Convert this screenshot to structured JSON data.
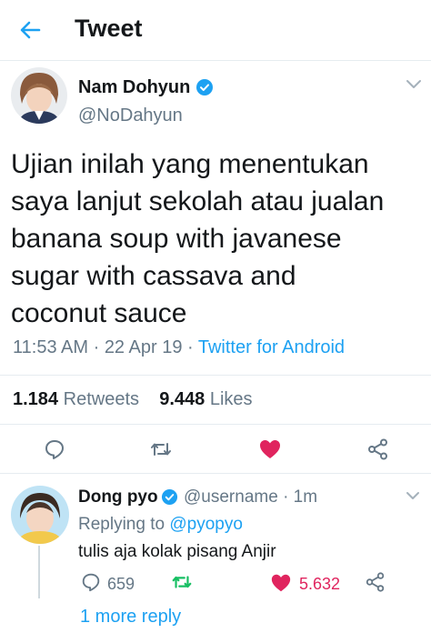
{
  "header": {
    "title": "Tweet"
  },
  "tweet": {
    "author_name": "Nam Dohyun",
    "author_handle": "@NoDahyun",
    "text_lines": [
      "Ujian inilah yang menentukan",
      "saya lanjut sekolah atau jualan",
      "banana soup with javanese",
      "sugar with cassava and",
      "coconut sauce"
    ],
    "time": "11:53 AM",
    "date": "22 Apr 19",
    "source": "Twitter for Android",
    "retweets_count": "1.184",
    "retweets_label": "Retweets",
    "likes_count": "9.448",
    "likes_label": "Likes",
    "liked": true
  },
  "reply": {
    "author_name": "Dong pyo",
    "author_handle": "@username",
    "time_ago": "1m",
    "replying_label": "Replying to",
    "replying_to": "@pyopyo",
    "text": "tulis aja kolak pisang Anjir",
    "replies_count": "659",
    "likes_count": "5.632",
    "more_replies": "1 more reply"
  },
  "colors": {
    "accent": "#1da1f2",
    "like": "#e0245e",
    "retweet": "#17bf63",
    "secondary_text": "#657786"
  },
  "icons": {
    "back": "arrow-left-icon",
    "verified": "verified-badge-icon",
    "caret": "chevron-down-icon",
    "reply": "comment-bubble-icon",
    "retweet": "retweet-icon",
    "like": "heart-icon",
    "share": "share-icon"
  }
}
